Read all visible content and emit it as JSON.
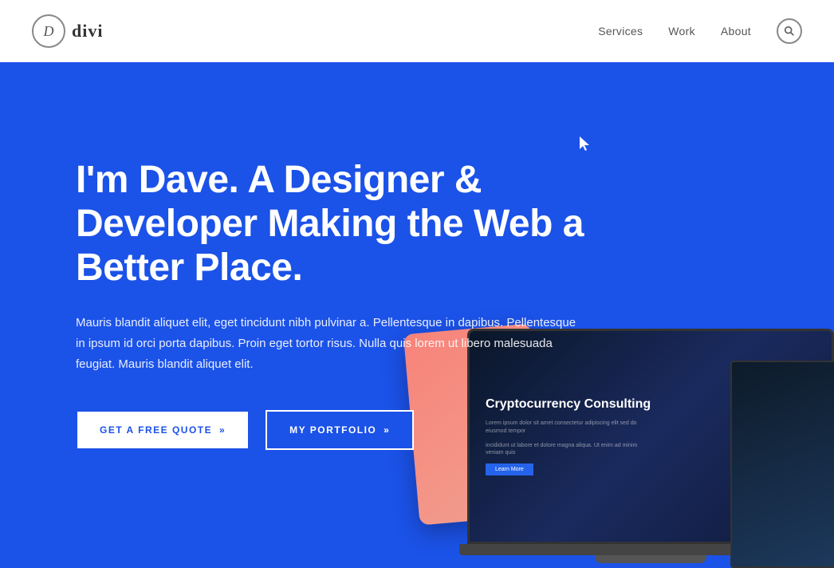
{
  "header": {
    "logo_letter": "D",
    "logo_name": "divi",
    "nav": {
      "services_label": "Services",
      "work_label": "Work",
      "about_label": "About"
    }
  },
  "hero": {
    "title": "I'm Dave. A Designer & Developer Making the Web a Better Place.",
    "description": "Mauris blandit aliquet elit, eget tincidunt nibh pulvinar a. Pellentesque in dapibus. Pellentesque in ipsum id orci porta dapibus. Proin eget tortor risus. Nulla quis lorem ut libero malesuada feugiat. Mauris blandit aliquet elit.",
    "btn_quote_label": "GET A FREE QUOTE",
    "btn_quote_arrow": "»",
    "btn_portfolio_label": "MY PORTFOLIO",
    "btn_portfolio_arrow": "»",
    "screen_heading": "Cryptocurrency Consulting",
    "screen_text_line1": "Lorem ipsum dolor sit amet consectetur adipiscing elit sed do eiusmod tempor",
    "screen_text_line2": "incididunt ut labore et dolore magna aliqua. Ut enim ad minim veniam quis",
    "screen_btn_label": "Learn More"
  },
  "colors": {
    "hero_bg": "#1B52E8",
    "header_bg": "#ffffff",
    "btn_outline_bg": "#ffffff",
    "btn_outline_text": "#1B52E8",
    "btn_solid_border": "#ffffff",
    "btn_solid_text": "#ffffff"
  }
}
